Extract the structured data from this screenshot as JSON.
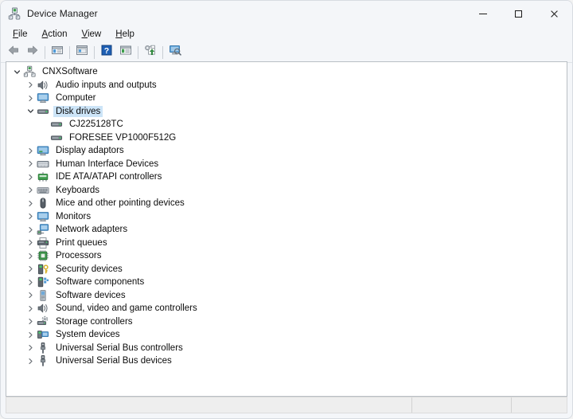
{
  "window": {
    "title": "Device Manager",
    "icon": "device-manager-icon",
    "controls": {
      "minimize": "—",
      "maximize": "□",
      "close": "✕"
    }
  },
  "menubar": {
    "items": [
      {
        "label": "File",
        "accel": "F",
        "name": "menu-file"
      },
      {
        "label": "Action",
        "accel": "A",
        "name": "menu-action"
      },
      {
        "label": "View",
        "accel": "V",
        "name": "menu-view"
      },
      {
        "label": "Help",
        "accel": "H",
        "name": "menu-help"
      }
    ]
  },
  "toolbar": {
    "buttons": [
      {
        "name": "back-button",
        "icon": "arrow-left-icon",
        "tooltip": "Back"
      },
      {
        "name": "forward-button",
        "icon": "arrow-right-icon",
        "tooltip": "Forward"
      },
      {
        "name": "show-hide-console-tree-button",
        "icon": "console-tree-icon",
        "tooltip": "Show/Hide Console Tree"
      },
      {
        "name": "properties-button",
        "icon": "properties-icon",
        "tooltip": "Properties"
      },
      {
        "name": "help-button",
        "icon": "help-question-icon",
        "tooltip": "Help"
      },
      {
        "name": "view-devices-button",
        "icon": "device-list-icon",
        "tooltip": "View"
      },
      {
        "name": "update-driver-button",
        "icon": "update-driver-icon",
        "tooltip": "Update driver"
      },
      {
        "name": "scan-hardware-button",
        "icon": "scan-hardware-icon",
        "tooltip": "Scan for hardware changes"
      }
    ]
  },
  "tree": {
    "nodes": [
      {
        "label": "CNXSoftware",
        "level": 0,
        "state": "expanded",
        "icon": "computer-tree-icon",
        "selected": false
      },
      {
        "label": "Audio inputs and outputs",
        "level": 1,
        "state": "collapsed",
        "icon": "speaker-icon",
        "selected": false
      },
      {
        "label": "Computer",
        "level": 1,
        "state": "collapsed",
        "icon": "monitor-icon",
        "selected": false
      },
      {
        "label": "Disk drives",
        "level": 1,
        "state": "expanded",
        "icon": "disk-drive-icon",
        "selected": true
      },
      {
        "label": "CJ225128TC",
        "level": 2,
        "state": "leaf",
        "icon": "disk-drive-icon",
        "selected": false
      },
      {
        "label": "FORESEE VP1000F512G",
        "level": 2,
        "state": "leaf",
        "icon": "disk-drive-icon",
        "selected": false
      },
      {
        "label": "Display adaptors",
        "level": 1,
        "state": "collapsed",
        "icon": "display-adapter-icon",
        "selected": false
      },
      {
        "label": "Human Interface Devices",
        "level": 1,
        "state": "collapsed",
        "icon": "hid-icon",
        "selected": false
      },
      {
        "label": "IDE ATA/ATAPI controllers",
        "level": 1,
        "state": "collapsed",
        "icon": "ide-controller-icon",
        "selected": false
      },
      {
        "label": "Keyboards",
        "level": 1,
        "state": "collapsed",
        "icon": "keyboard-icon",
        "selected": false
      },
      {
        "label": "Mice and other pointing devices",
        "level": 1,
        "state": "collapsed",
        "icon": "mouse-icon",
        "selected": false
      },
      {
        "label": "Monitors",
        "level": 1,
        "state": "collapsed",
        "icon": "monitor-icon",
        "selected": false
      },
      {
        "label": "Network adapters",
        "level": 1,
        "state": "collapsed",
        "icon": "network-adapter-icon",
        "selected": false
      },
      {
        "label": "Print queues",
        "level": 1,
        "state": "collapsed",
        "icon": "printer-icon",
        "selected": false
      },
      {
        "label": "Processors",
        "level": 1,
        "state": "collapsed",
        "icon": "processor-icon",
        "selected": false
      },
      {
        "label": "Security devices",
        "level": 1,
        "state": "collapsed",
        "icon": "security-device-icon",
        "selected": false
      },
      {
        "label": "Software components",
        "level": 1,
        "state": "collapsed",
        "icon": "software-component-icon",
        "selected": false
      },
      {
        "label": "Software devices",
        "level": 1,
        "state": "collapsed",
        "icon": "software-device-icon",
        "selected": false
      },
      {
        "label": "Sound, video and game controllers",
        "level": 1,
        "state": "collapsed",
        "icon": "speaker-icon",
        "selected": false
      },
      {
        "label": "Storage controllers",
        "level": 1,
        "state": "collapsed",
        "icon": "storage-controller-icon",
        "selected": false
      },
      {
        "label": "System devices",
        "level": 1,
        "state": "collapsed",
        "icon": "system-device-icon",
        "selected": false
      },
      {
        "label": "Universal Serial Bus controllers",
        "level": 1,
        "state": "collapsed",
        "icon": "usb-icon",
        "selected": false
      },
      {
        "label": "Universal Serial Bus devices",
        "level": 1,
        "state": "collapsed",
        "icon": "usb-icon",
        "selected": false
      }
    ]
  },
  "statusbar": {
    "panes": [
      "",
      "",
      ""
    ]
  },
  "colors": {
    "selection": "#cce4f7",
    "window_bg": "#f4f6f9",
    "content_bg": "#ffffff",
    "text": "#0c0c0c",
    "help_blue": "#1e5fb4"
  }
}
